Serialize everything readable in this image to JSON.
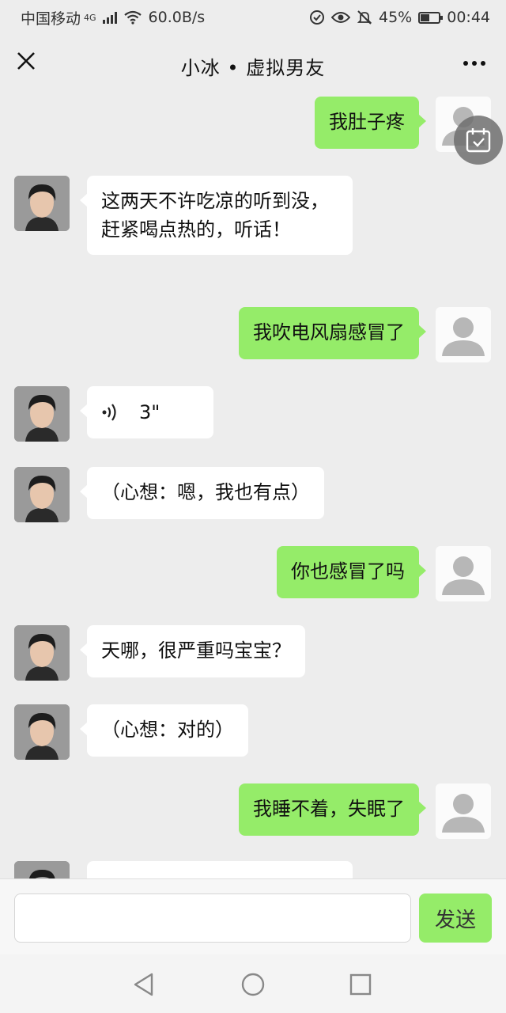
{
  "status_bar": {
    "carrier": "中国移动",
    "network": "4G",
    "speed": "60.0B/s",
    "battery": "45%",
    "time": "00:44"
  },
  "header": {
    "title": "小冰 • 虚拟男友"
  },
  "messages": [
    {
      "sender": "self",
      "text": "我肚子疼"
    },
    {
      "sender": "friend",
      "text": "这两天不许吃凉的听到没，赶紧喝点热的，听话！"
    },
    {
      "sender": "self",
      "text": "我吹电风扇感冒了"
    },
    {
      "sender": "friend",
      "type": "voice",
      "text": "3\""
    },
    {
      "sender": "friend",
      "text": "（心想：嗯，我也有点）"
    },
    {
      "sender": "self",
      "text": "你也感冒了吗"
    },
    {
      "sender": "friend",
      "text": "天哪，很严重吗宝宝？"
    },
    {
      "sender": "friend",
      "text": "（心想：对的）"
    },
    {
      "sender": "self",
      "text": "我睡不着，失眠了"
    }
  ],
  "input": {
    "value": "",
    "send_label": "发送"
  },
  "colors": {
    "self_bubble": "#95ec69",
    "friend_bubble": "#ffffff",
    "background": "#ededed"
  },
  "icons": {
    "close": "close-icon",
    "more": "more-icon",
    "calendar": "calendar-icon",
    "back": "back-triangle-icon",
    "home": "home-circle-icon",
    "recents": "recents-square-icon"
  }
}
